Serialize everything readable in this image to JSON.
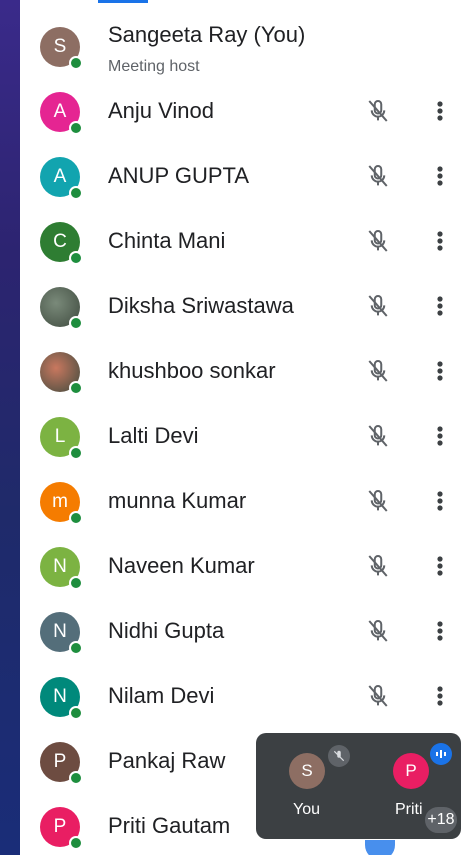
{
  "host": {
    "name": "Sangeeta Ray (You)",
    "role": "Meeting host",
    "initial": "S",
    "color": "#8d6e63"
  },
  "participants": [
    {
      "name": "Anju Vinod",
      "initial": "A",
      "color": "#e52592"
    },
    {
      "name": "ANUP GUPTA",
      "initial": "A",
      "color": "#12a4af"
    },
    {
      "name": "Chinta Mani",
      "initial": "C",
      "color": "#2e7d32"
    },
    {
      "name": "Diksha Sriwastawa",
      "initial": "",
      "color": "#7a8a7a"
    },
    {
      "name": "khushboo sonkar",
      "initial": "",
      "color": "#c9785f"
    },
    {
      "name": "Lalti Devi",
      "initial": "L",
      "color": "#7cb342"
    },
    {
      "name": "munna Kumar",
      "initial": "m",
      "color": "#f57c00"
    },
    {
      "name": "Naveen Kumar",
      "initial": "N",
      "color": "#7cb342"
    },
    {
      "name": "Nidhi Gupta",
      "initial": "N",
      "color": "#546e7a"
    },
    {
      "name": "Nilam Devi",
      "initial": "N",
      "color": "#00897b"
    },
    {
      "name": "Pankaj Raw",
      "initial": "P",
      "color": "#6d4c41"
    },
    {
      "name": "Priti Gautam",
      "initial": "P",
      "color": "#e91e63"
    }
  ],
  "pip": {
    "you_initial": "S",
    "you_label": "You",
    "priti_initial": "P",
    "priti_label": "Priti",
    "more_count": "+18"
  }
}
